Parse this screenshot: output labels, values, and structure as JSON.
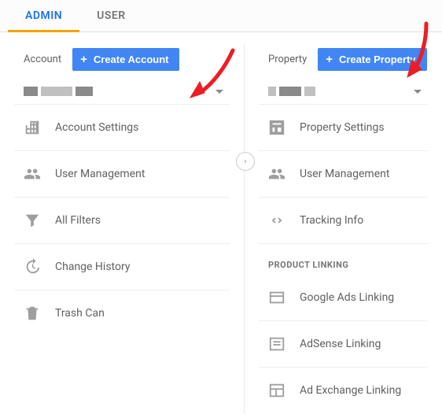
{
  "tabs": {
    "admin": "ADMIN",
    "user": "USER"
  },
  "account": {
    "label": "Account",
    "create": "Create Account",
    "items": {
      "settings": "Account Settings",
      "users": "User Management",
      "filters": "All Filters",
      "history": "Change History",
      "trash": "Trash Can"
    }
  },
  "property": {
    "label": "Property",
    "create": "Create Property",
    "items": {
      "settings": "Property Settings",
      "users": "User Management",
      "tracking": "Tracking Info"
    },
    "product_linking_header": "PRODUCT LINKING",
    "product_linking": {
      "ads": "Google Ads Linking",
      "adsense": "AdSense Linking",
      "adexchange": "Ad Exchange Linking"
    }
  }
}
